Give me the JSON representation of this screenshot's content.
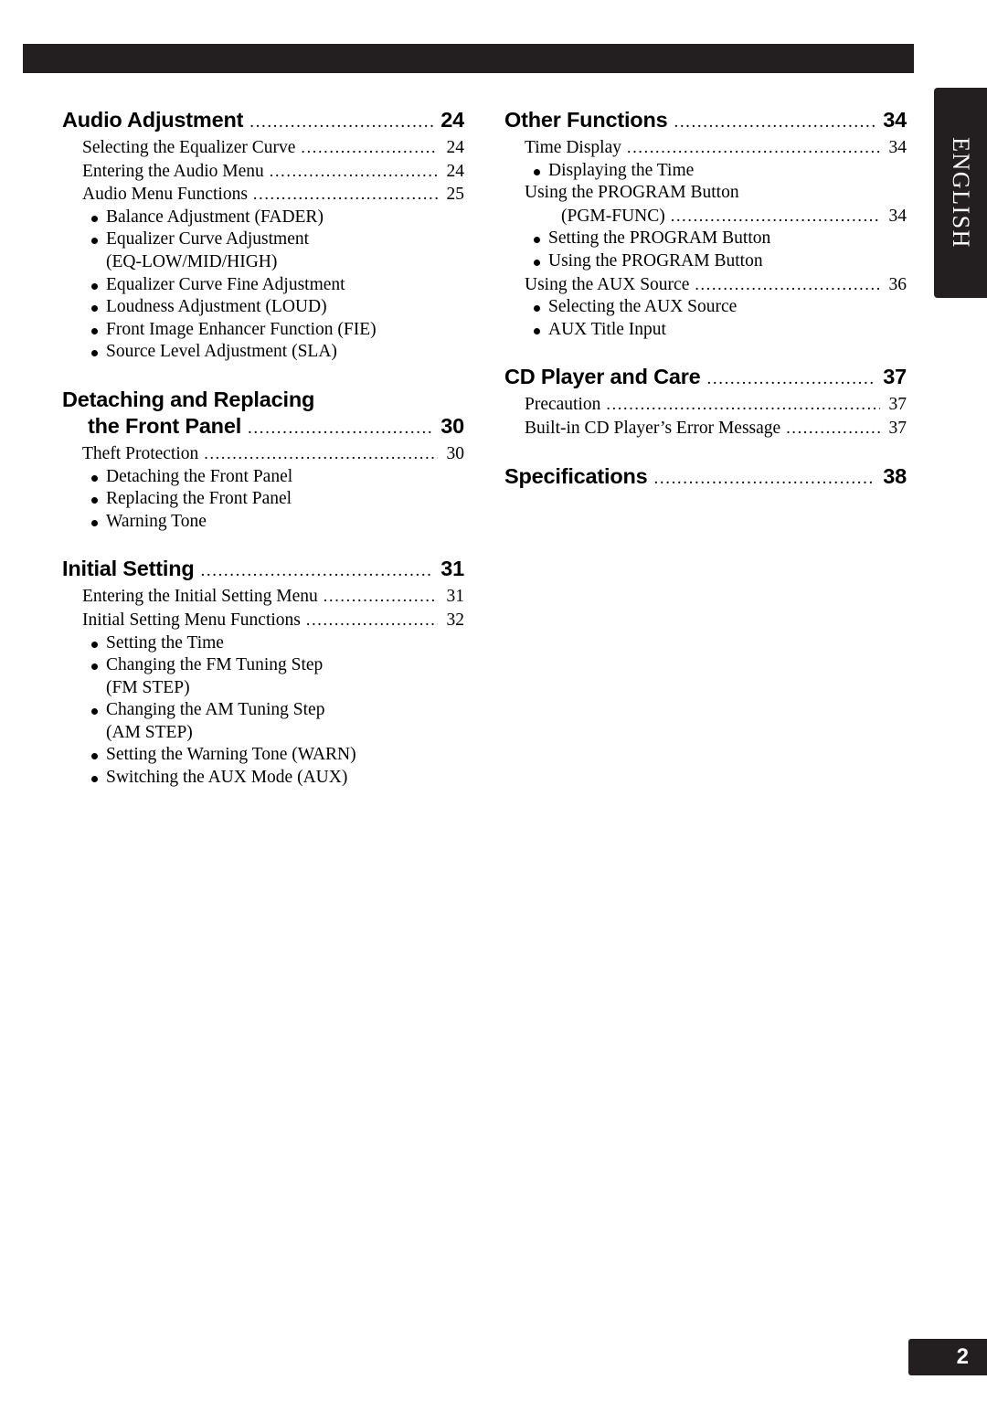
{
  "page": {
    "number": "2",
    "side_tab": "ENGLISH"
  },
  "left_column": [
    {
      "type": "heading",
      "title": "Audio Adjustment",
      "page": "24"
    },
    {
      "type": "entry",
      "title": "Selecting the Equalizer Curve",
      "page": "24"
    },
    {
      "type": "entry",
      "title": "Entering the Audio Menu",
      "page": "24"
    },
    {
      "type": "entry",
      "title": "Audio Menu Functions",
      "page": "25"
    },
    {
      "type": "bullet",
      "title": "Balance Adjustment (FADER)"
    },
    {
      "type": "bullet",
      "title": "Equalizer Curve Adjustment"
    },
    {
      "type": "cont",
      "title": "(EQ-LOW/MID/HIGH)"
    },
    {
      "type": "bullet",
      "title": "Equalizer Curve Fine Adjustment"
    },
    {
      "type": "bullet",
      "title": "Loudness Adjustment (LOUD)"
    },
    {
      "type": "bullet",
      "title": "Front Image Enhancer Function (FIE)"
    },
    {
      "type": "bullet",
      "title": "Source Level Adjustment (SLA)"
    },
    {
      "type": "heading2",
      "title_line1": "Detaching and Replacing",
      "title_line2": "the Front Panel",
      "page": "30"
    },
    {
      "type": "entry",
      "title": "Theft Protection",
      "page": "30"
    },
    {
      "type": "bullet",
      "title": "Detaching the Front Panel"
    },
    {
      "type": "bullet",
      "title": "Replacing the Front Panel"
    },
    {
      "type": "bullet",
      "title": "Warning Tone"
    },
    {
      "type": "heading",
      "title": "Initial Setting",
      "page": "31"
    },
    {
      "type": "entry",
      "title": "Entering the Initial Setting Menu",
      "page": "31"
    },
    {
      "type": "entry",
      "title": "Initial Setting Menu Functions",
      "page": "32"
    },
    {
      "type": "bullet",
      "title": "Setting the Time"
    },
    {
      "type": "bullet",
      "title": "Changing the FM Tuning Step"
    },
    {
      "type": "cont",
      "title": "(FM STEP)"
    },
    {
      "type": "bullet",
      "title": "Changing the AM Tuning Step"
    },
    {
      "type": "cont",
      "title": "(AM STEP)"
    },
    {
      "type": "bullet",
      "title": "Setting the Warning Tone (WARN)"
    },
    {
      "type": "bullet",
      "title": "Switching the AUX Mode (AUX)"
    }
  ],
  "right_column": [
    {
      "type": "heading",
      "title": "Other Functions",
      "page": "34"
    },
    {
      "type": "entry",
      "title": "Time Display",
      "page": "34"
    },
    {
      "type": "bullet",
      "title": "Displaying the Time"
    },
    {
      "type": "plain",
      "title": "Using the PROGRAM Button"
    },
    {
      "type": "entry_indent",
      "title": "(PGM-FUNC)",
      "page": "34"
    },
    {
      "type": "bullet",
      "title": "Setting the PROGRAM Button"
    },
    {
      "type": "bullet",
      "title": "Using the PROGRAM Button"
    },
    {
      "type": "entry",
      "title": "Using the AUX Source",
      "page": "36"
    },
    {
      "type": "bullet",
      "title": "Selecting the AUX Source"
    },
    {
      "type": "bullet",
      "title": "AUX Title Input"
    },
    {
      "type": "heading",
      "title": "CD Player and Care",
      "page": "37"
    },
    {
      "type": "entry",
      "title": "Precaution",
      "page": "37"
    },
    {
      "type": "entry",
      "title": "Built-in CD Player’s Error Message",
      "page": "37"
    },
    {
      "type": "heading",
      "title": "Specifications",
      "page": "38"
    }
  ]
}
